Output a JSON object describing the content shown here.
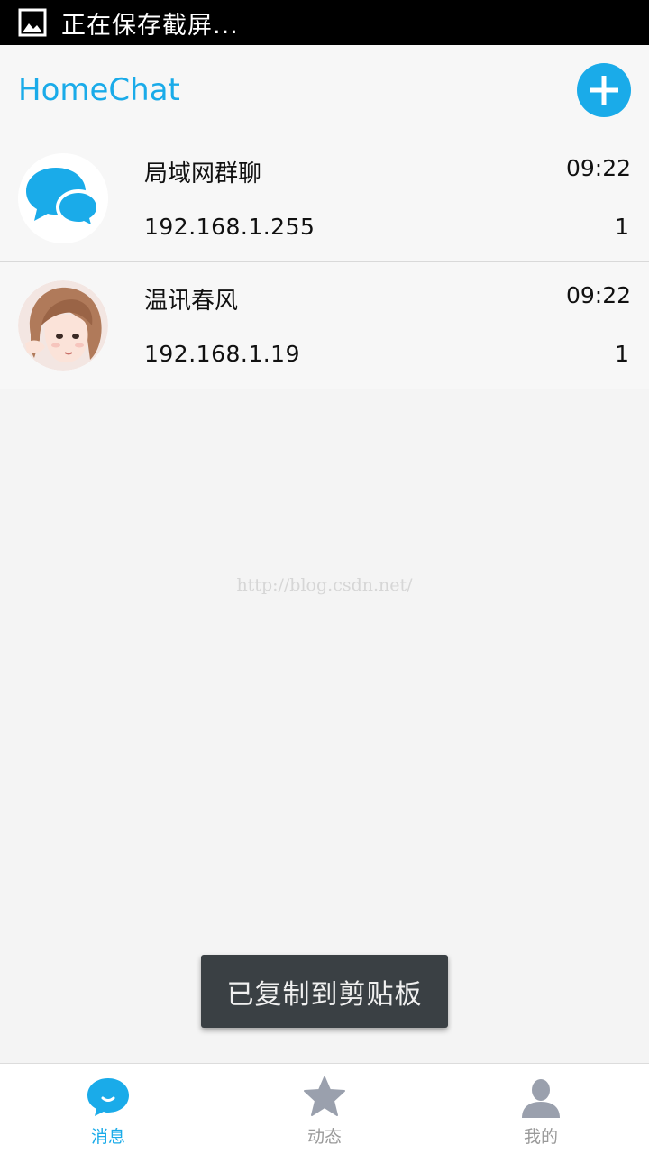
{
  "status_bar": {
    "text": "正在保存截屏..."
  },
  "header": {
    "title": "HomeChat"
  },
  "chats": [
    {
      "name": "局域网群聊",
      "ip": "192.168.1.255",
      "time": "09:22",
      "count": "1",
      "avatar_icon": "group-chat-bubbles-icon"
    },
    {
      "name": "温讯春风",
      "ip": "192.168.1.19",
      "time": "09:22",
      "count": "1",
      "avatar_icon": "user-portrait-avatar"
    }
  ],
  "watermark": "http://blog.csdn.net/",
  "toast": "已复制到剪贴板",
  "nav": {
    "items": [
      {
        "label": "消息",
        "icon": "chat-bubble-icon",
        "active": true
      },
      {
        "label": "动态",
        "icon": "star-icon",
        "active": false
      },
      {
        "label": "我的",
        "icon": "person-icon",
        "active": false
      }
    ]
  },
  "colors": {
    "accent": "#1aabe9",
    "inactive": "#9aa0ad",
    "toast_bg": "#3a4044"
  }
}
